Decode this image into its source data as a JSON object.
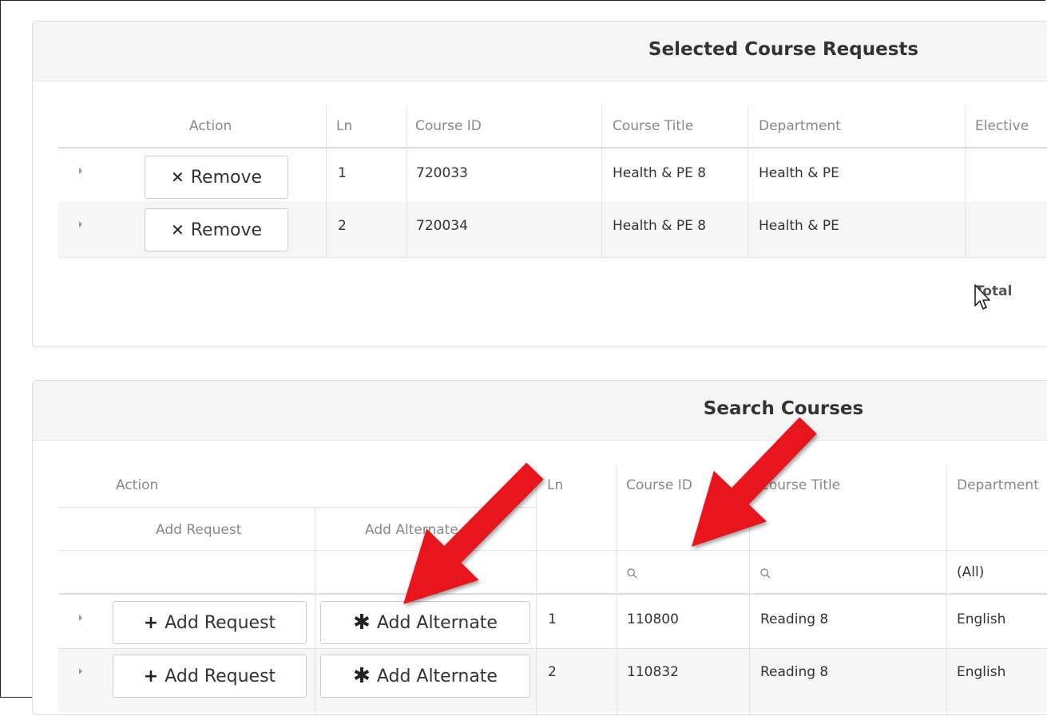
{
  "selected_panel": {
    "title": "Selected Course Requests",
    "columns": {
      "action": "Action",
      "ln": "Ln",
      "course_id": "Course ID",
      "course_title": "Course Title",
      "department": "Department",
      "elective": "Elective"
    },
    "rows": [
      {
        "action_label": "Remove",
        "ln": "1",
        "course_id": "720033",
        "course_title": "Health & PE 8",
        "department": "Health & PE",
        "elective": ""
      },
      {
        "action_label": "Remove",
        "ln": "2",
        "course_id": "720034",
        "course_title": "Health & PE 8",
        "department": "Health & PE",
        "elective": ""
      }
    ],
    "footer_total": "Total"
  },
  "search_panel": {
    "title": "Search Courses",
    "columns": {
      "action": "Action",
      "add_request": "Add Request",
      "add_alternate": "Add Alternate",
      "ln": "Ln",
      "course_id": "Course ID",
      "course_title": "Course Title",
      "department": "Department"
    },
    "filters": {
      "department": "(All)"
    },
    "rows": [
      {
        "add_request_label": "Add Request",
        "add_alternate_label": "Add Alternate",
        "ln": "1",
        "course_id": "110800",
        "course_title": "Reading 8",
        "department": "English"
      },
      {
        "add_request_label": "Add Request",
        "add_alternate_label": "Add Alternate",
        "ln": "2",
        "course_id": "110832",
        "course_title": "Reading 8",
        "department": "English"
      }
    ]
  },
  "annotations": {
    "arrow_color": "#e8141c"
  },
  "icons": {
    "remove": "x-icon",
    "add_request": "plus-icon",
    "add_alternate": "asterisk-icon",
    "filter": "search-icon",
    "expand": "caret-right-icon",
    "cursor": "mouse-pointer-icon"
  }
}
